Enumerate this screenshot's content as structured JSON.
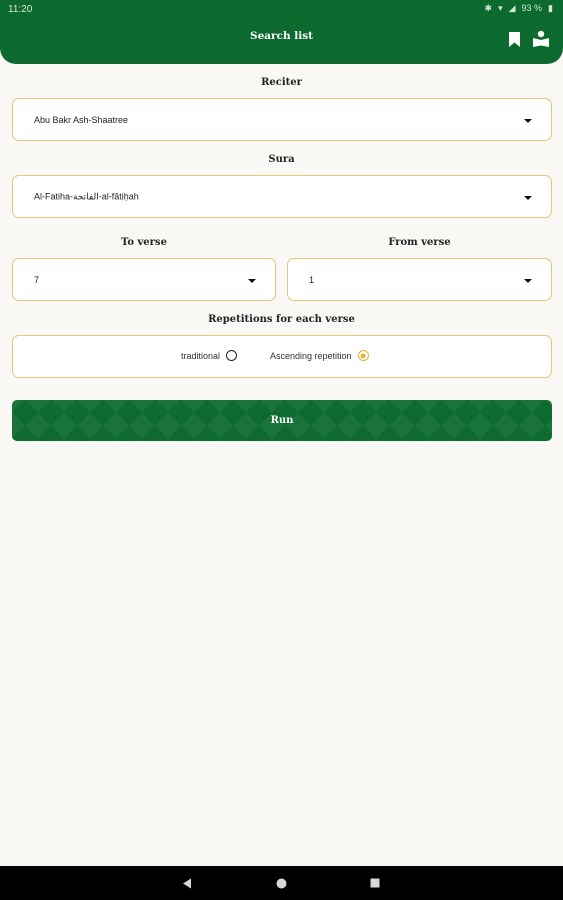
{
  "status_bar": {
    "time": "11:20",
    "icons": [
      "bluetooth-icon",
      "wifi-icon",
      "signal-icon",
      "battery-icon"
    ],
    "battery": "93 %"
  },
  "app_bar": {
    "title": "Search list",
    "actions": [
      "bookmark-icon",
      "reading-icon"
    ]
  },
  "form": {
    "reciter": {
      "label": "Reciter",
      "value": "Abu Bakr Ash-Shaatree"
    },
    "sura": {
      "label": "Sura",
      "value": "Al-Fatiha-الفاتحة-al-fātiḥah"
    },
    "to_verse": {
      "label": "To verse",
      "value": "7"
    },
    "from_verse": {
      "label": "From verse",
      "value": "1"
    },
    "repetitions": {
      "label": "Repetitions for each verse",
      "options": [
        {
          "label": "traditional",
          "selected": false
        },
        {
          "label": "Ascending repetition",
          "selected": true
        }
      ]
    },
    "run_label": "Run"
  },
  "colors": {
    "primary": "#0c6a2e",
    "accent": "#e8b33a",
    "field_border": "#e3c878",
    "background": "#f9f8f4"
  },
  "nav_bar": {
    "icons": [
      "back-icon",
      "home-icon",
      "recents-icon"
    ]
  }
}
